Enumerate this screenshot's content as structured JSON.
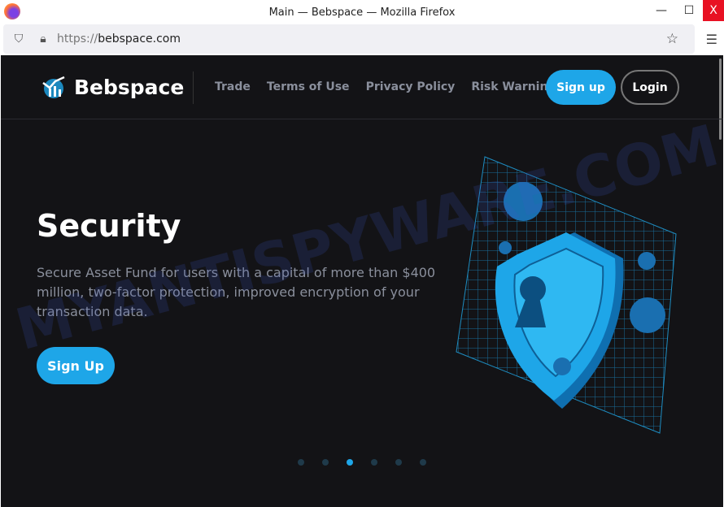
{
  "browser": {
    "title": "Main — Bebspace — Mozilla Firefox",
    "url_scheme": "https://",
    "url_host": "bebspace.com",
    "minimize": "—",
    "maximize": "☐",
    "close": "X"
  },
  "site": {
    "brand": "Bebspace",
    "nav": [
      "Trade",
      "Terms of Use",
      "Privacy Policy",
      "Risk Warnings"
    ],
    "signup": "Sign up",
    "login": "Login",
    "hero": {
      "title": "Security",
      "description": "Secure Asset Fund for users with a capital of more than $400 million, two-factor protection, improved encryption of your transaction data.",
      "cta": "Sign Up"
    },
    "slides": 6,
    "active_slide": 3
  },
  "colors": {
    "accent": "#1ea6e8",
    "background": "#131316"
  },
  "watermark": "MYANTISPYWARE.COM"
}
